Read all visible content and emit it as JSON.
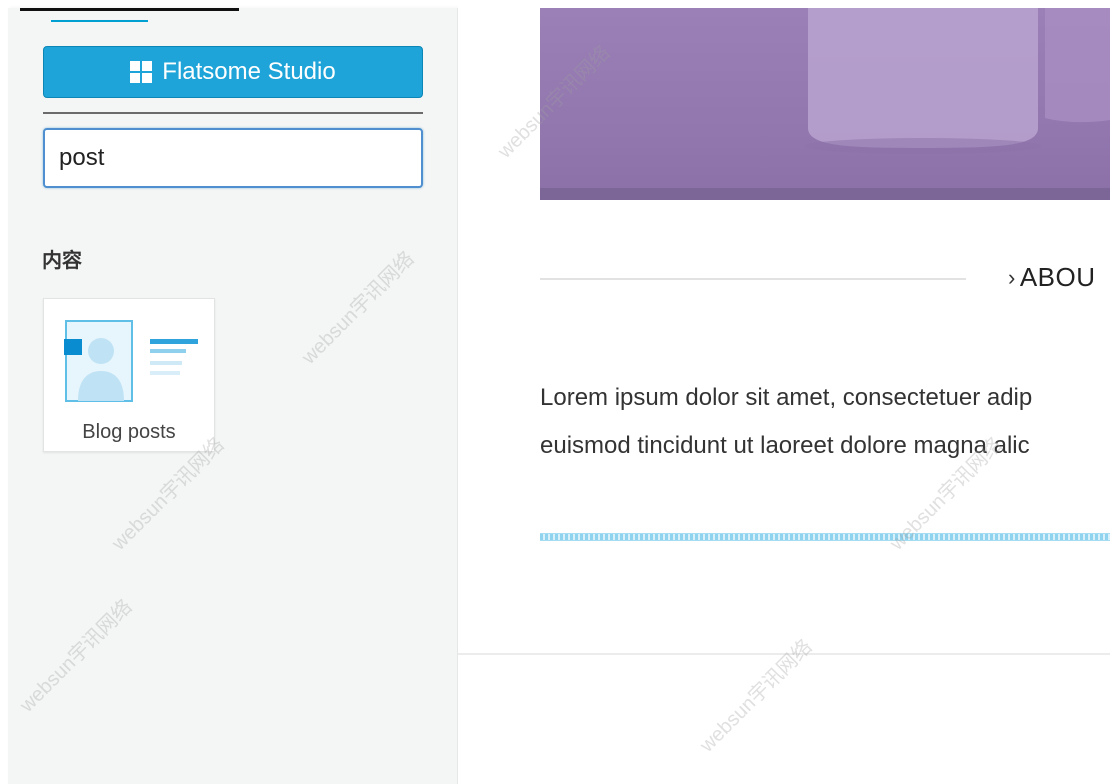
{
  "sidebar": {
    "studio_button_label": "Flatsome Studio",
    "search": {
      "value": "post"
    },
    "section_heading": "内容",
    "elements": [
      {
        "label": "Blog posts",
        "icon": "blog-posts-icon"
      }
    ]
  },
  "content": {
    "section_title": "ABOU",
    "body_lines": [
      "Lorem ipsum dolor sit amet, consectetuer adip",
      "euismod tincidunt ut laoreet dolore magna alic"
    ]
  },
  "watermark_text": "websun宇讯网络",
  "colors": {
    "accent": "#1ea4d8",
    "hero_purple": "#9a80b6",
    "sidebar_bg": "#f4f5f5",
    "focus_border": "#4f8fd0"
  }
}
